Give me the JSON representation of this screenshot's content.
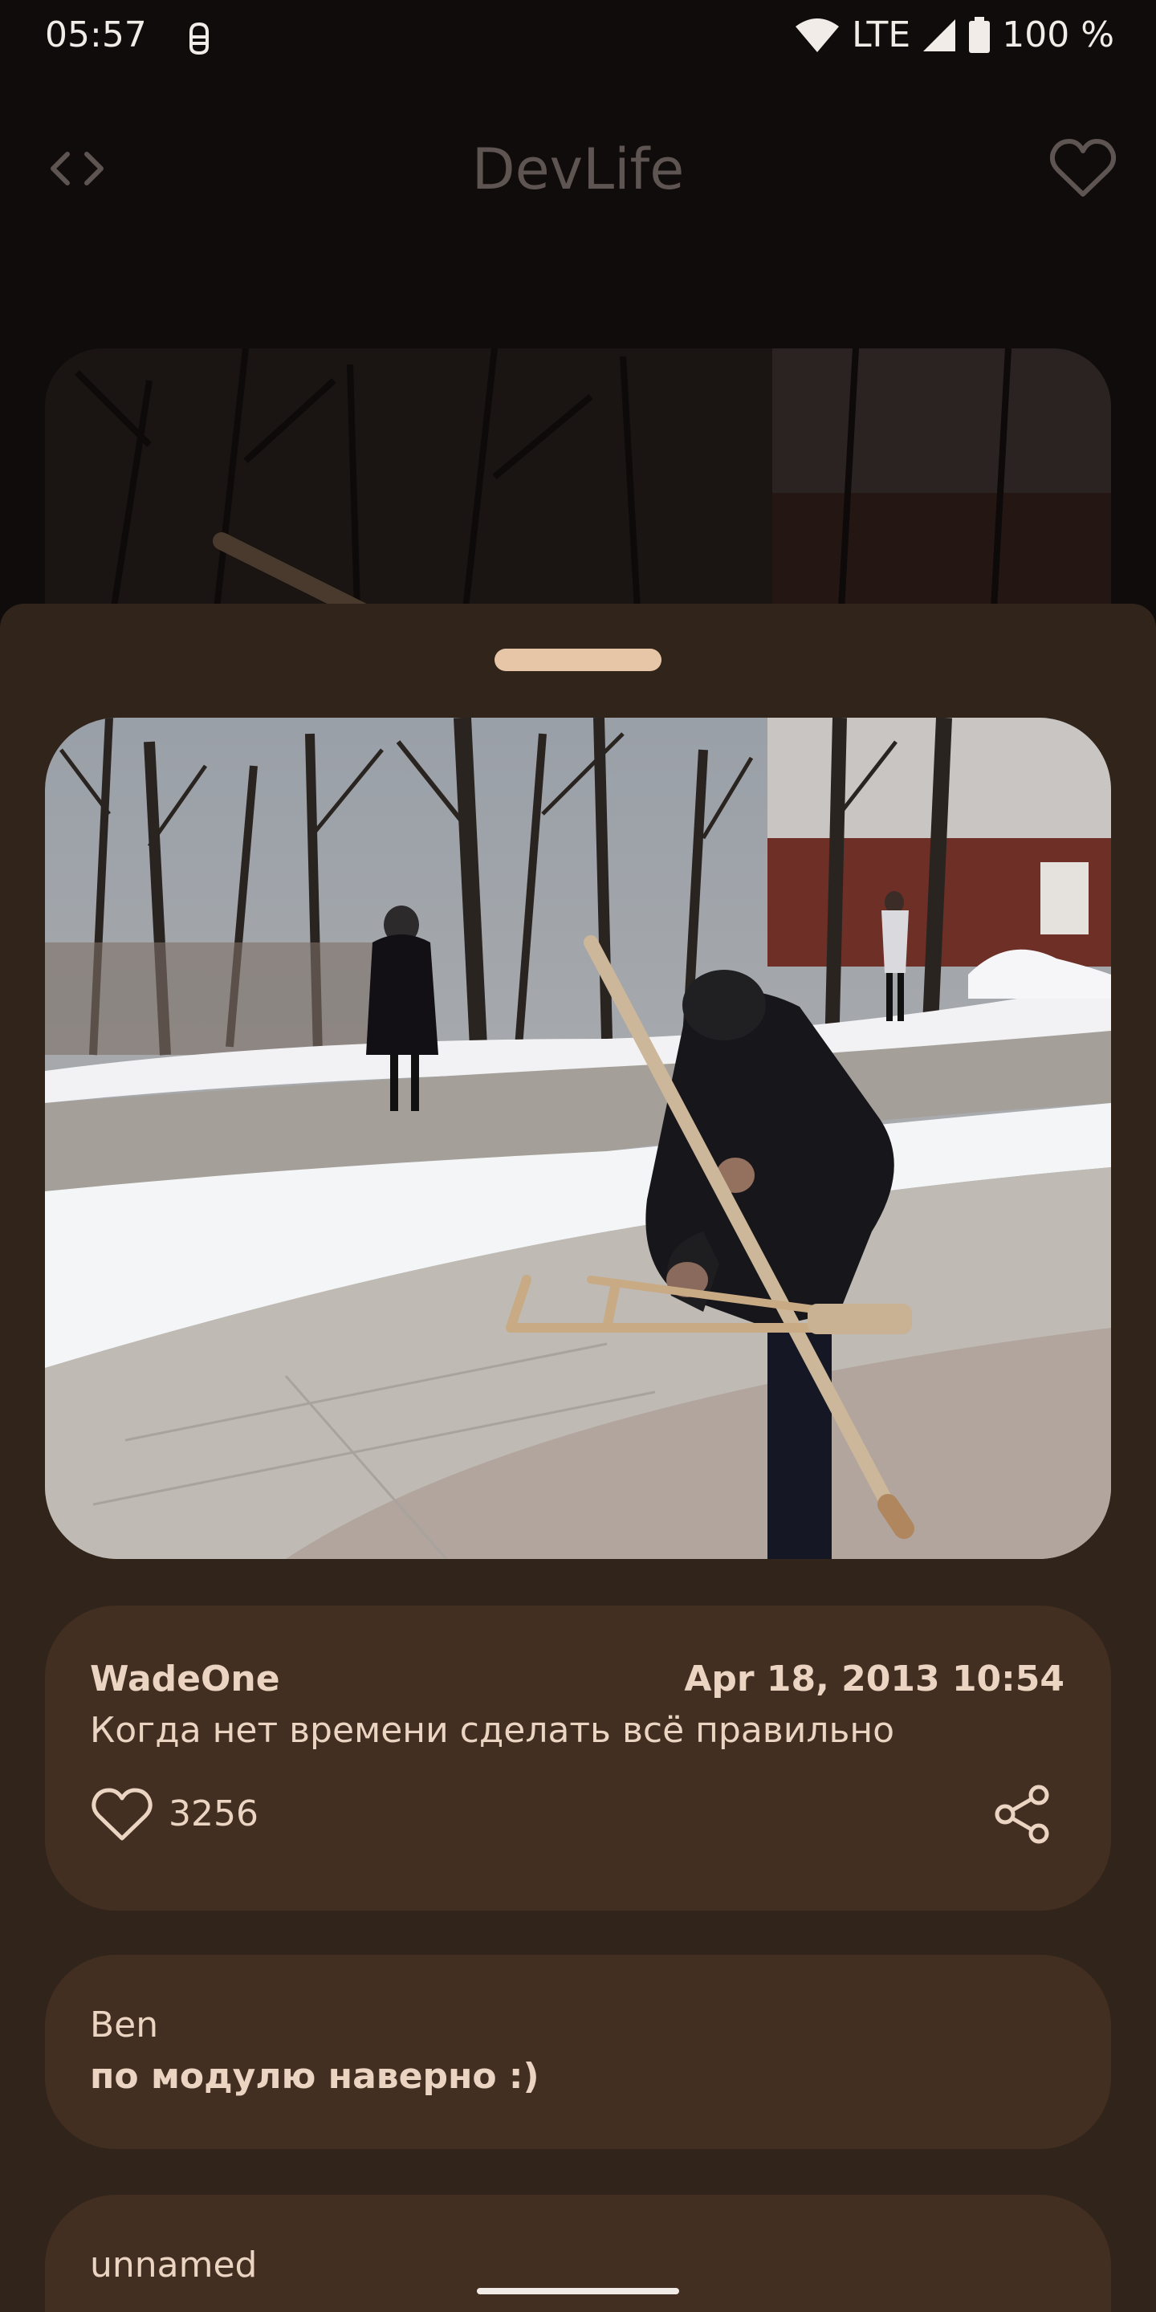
{
  "status_bar": {
    "time": "05:57",
    "network": "LTE",
    "battery": "100 %",
    "icons": [
      "app-notification-icon",
      "wifi-icon",
      "signal-icon",
      "battery-icon"
    ]
  },
  "app_bar": {
    "title": "DevLife",
    "left_icon": "code-icon",
    "right_icon": "favorite-outline-icon"
  },
  "post": {
    "author": "WadeOne",
    "date": "Apr 18, 2013 10:54",
    "description": "Когда нет времени сделать всё правильно",
    "likes": "3256",
    "like_icon": "heart-outline-icon",
    "share_icon": "share-icon"
  },
  "comments": [
    {
      "author": "Ben",
      "text": "по модулю наверно :)"
    },
    {
      "author": "unnamed",
      "text": ""
    }
  ],
  "colors": {
    "background": "#0f0c0b",
    "sheet": "#31241b",
    "card": "#432f22",
    "text": "#ebd4c1",
    "handle": "#e7c6a7",
    "title_dimmed": "#5e5451"
  }
}
